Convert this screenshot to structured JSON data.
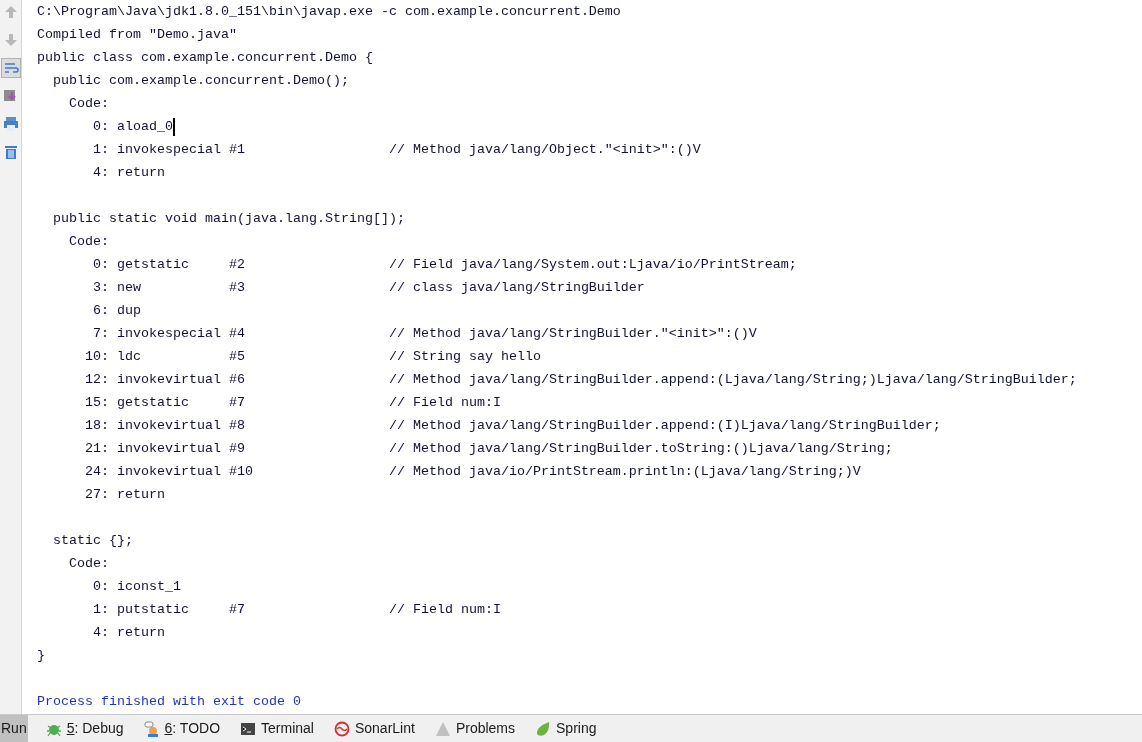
{
  "toolbar": {
    "buttons": [
      {
        "kind": "up",
        "selected": false
      },
      {
        "kind": "down",
        "selected": false
      },
      {
        "kind": "wrap",
        "selected": true
      },
      {
        "kind": "scroll",
        "selected": false
      },
      {
        "kind": "print",
        "selected": false
      },
      {
        "kind": "trash",
        "selected": false
      }
    ]
  },
  "console": {
    "lines": [
      {
        "kind": "text",
        "text": "C:\\Program\\Java\\jdk1.8.0_151\\bin\\javap.exe -c com.example.concurrent.Demo"
      },
      {
        "kind": "text",
        "text": "Compiled from \"Demo.java\""
      },
      {
        "kind": "text",
        "text": "public class com.example.concurrent.Demo {"
      },
      {
        "kind": "text",
        "text": "  public com.example.concurrent.Demo();"
      },
      {
        "kind": "text",
        "text": "    Code:"
      },
      {
        "kind": "text",
        "text": "       0: aload_0",
        "caret": true
      },
      {
        "kind": "text",
        "text": "       1: invokespecial #1                  // Method java/lang/Object.\"<init>\":()V"
      },
      {
        "kind": "text",
        "text": "       4: return"
      },
      {
        "kind": "blank"
      },
      {
        "kind": "text",
        "text": "  public static void main(java.lang.String[]);"
      },
      {
        "kind": "text",
        "text": "    Code:"
      },
      {
        "kind": "text",
        "text": "       0: getstatic     #2                  // Field java/lang/System.out:Ljava/io/PrintStream;"
      },
      {
        "kind": "text",
        "text": "       3: new           #3                  // class java/lang/StringBuilder"
      },
      {
        "kind": "text",
        "text": "       6: dup"
      },
      {
        "kind": "text",
        "text": "       7: invokespecial #4                  // Method java/lang/StringBuilder.\"<init>\":()V"
      },
      {
        "kind": "text",
        "text": "      10: ldc           #5                  // String say hello"
      },
      {
        "kind": "text",
        "text": "      12: invokevirtual #6                  // Method java/lang/StringBuilder.append:(Ljava/lang/String;)Ljava/lang/StringBuilder;"
      },
      {
        "kind": "text",
        "text": "      15: getstatic     #7                  // Field num:I"
      },
      {
        "kind": "text",
        "text": "      18: invokevirtual #8                  // Method java/lang/StringBuilder.append:(I)Ljava/lang/StringBuilder;"
      },
      {
        "kind": "text",
        "text": "      21: invokevirtual #9                  // Method java/lang/StringBuilder.toString:()Ljava/lang/String;"
      },
      {
        "kind": "text",
        "text": "      24: invokevirtual #10                 // Method java/io/PrintStream.println:(Ljava/lang/String;)V"
      },
      {
        "kind": "text",
        "text": "      27: return"
      },
      {
        "kind": "blank"
      },
      {
        "kind": "text",
        "text": "  static {};"
      },
      {
        "kind": "text",
        "text": "    Code:"
      },
      {
        "kind": "text",
        "text": "       0: iconst_1"
      },
      {
        "kind": "text",
        "text": "       1: putstatic     #7                  // Field num:I"
      },
      {
        "kind": "text",
        "text": "       4: return"
      },
      {
        "kind": "text",
        "text": "}"
      },
      {
        "kind": "blank"
      },
      {
        "kind": "status",
        "text": "Process finished with exit code 0"
      }
    ]
  },
  "bottom_bar": {
    "tabs": [
      {
        "kind": "run",
        "label": "Run",
        "selected": true
      },
      {
        "kind": "debug",
        "mnemonic": "5",
        "label": ": Debug",
        "selected": false
      },
      {
        "kind": "todo",
        "mnemonic": "6",
        "label": ": TODO",
        "selected": false
      },
      {
        "kind": "terminal",
        "label": "Terminal",
        "selected": false
      },
      {
        "kind": "sonarlint",
        "label": "SonarLint",
        "selected": false
      },
      {
        "kind": "problems",
        "label": "Problems",
        "selected": false
      },
      {
        "kind": "spring",
        "label": "Spring",
        "selected": false
      }
    ]
  }
}
